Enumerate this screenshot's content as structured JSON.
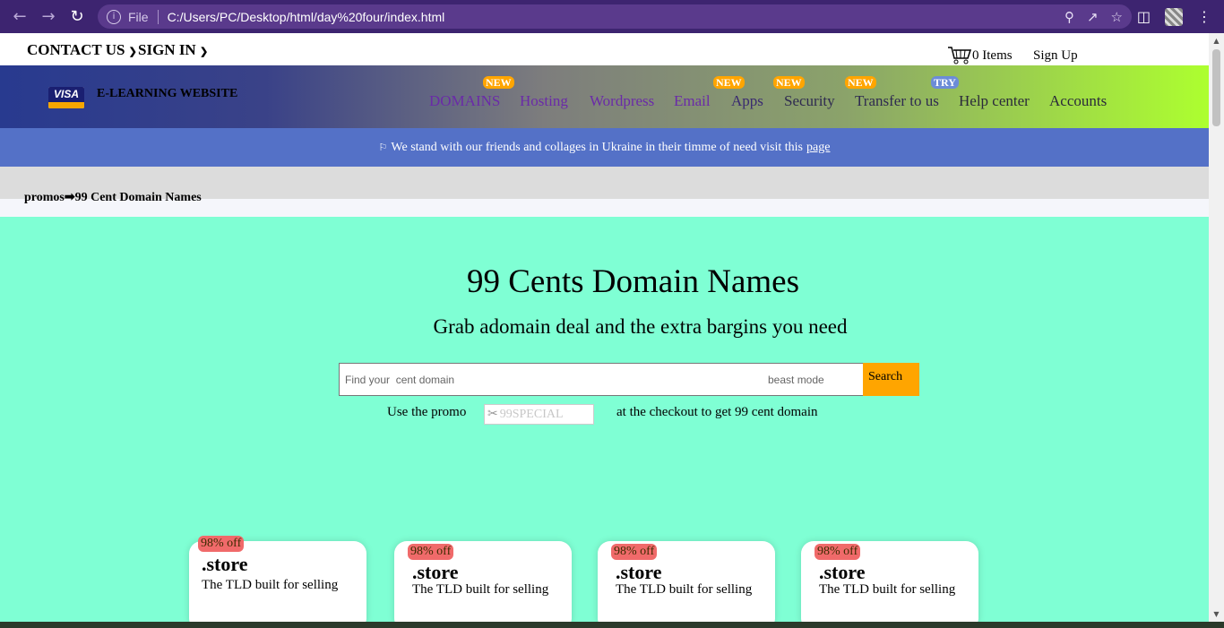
{
  "browser": {
    "scheme_label": "File",
    "url": "C:/Users/PC/Desktop/html/day%20four/index.html"
  },
  "topbar": {
    "contact_label": "CONTACT US",
    "signin_label": "SIGN IN",
    "cart_label": "0 Items",
    "signup_label": "Sign Up"
  },
  "header": {
    "brand": "E-LEARNING WEBSITE",
    "visa_label": "VISA",
    "nav": [
      {
        "label": "DOMAINS",
        "badge": "NEW"
      },
      {
        "label": "Hosting",
        "badge": ""
      },
      {
        "label": "Wordpress",
        "badge": ""
      },
      {
        "label": "Email",
        "badge": "NEW"
      },
      {
        "label": "Apps",
        "badge": "NEW"
      },
      {
        "label": "Security",
        "badge": ""
      },
      {
        "label": "Transfer to us",
        "badge": "NEW"
      },
      {
        "label": "Help center",
        "badge": "TRY"
      },
      {
        "label": "Accounts",
        "badge": ""
      }
    ]
  },
  "banner": {
    "text": "We stand with our friends and collages in Ukraine in their timme of need visit this",
    "link_label": "page"
  },
  "breadcrumb": "promos➡99 Cent Domain Names",
  "hero": {
    "title": "99 Cents Domain Names",
    "subtitle": "Grab adomain deal and the extra bargins you need",
    "search_placeholder": "Find your  cent domain",
    "search_mode": "beast mode",
    "search_button": "Search",
    "promo_prefix": "Use the promo",
    "promo_code": "99SPECIAL",
    "promo_suffix": "at the checkout to get 99 cent domain"
  },
  "cards": [
    {
      "discount": "98% off",
      "tld": ".store",
      "desc": "The TLD built for selling"
    },
    {
      "discount": "98% off",
      "tld": ".store",
      "desc": "The TLD built for selling"
    },
    {
      "discount": "98% off",
      "tld": ".store",
      "desc": "The TLD built for selling"
    },
    {
      "discount": "98% off",
      "tld": ".store",
      "desc": "The TLD built for selling"
    }
  ],
  "colors": {
    "page_bg": "#7fffd4",
    "banner_bg": "#5471c7",
    "badge_new": "#ffa500",
    "discount_bg": "#f06a6a",
    "nav_text": "#6a2aa8"
  }
}
